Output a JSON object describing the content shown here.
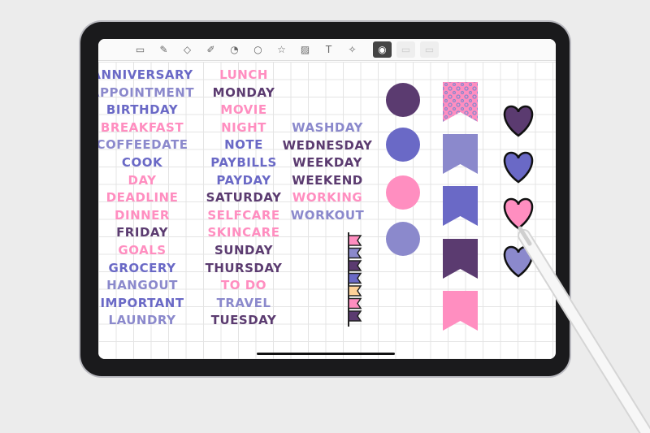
{
  "colors": {
    "dark": "#5b3b70",
    "indigo": "#6a69c6",
    "pink": "#ff8ec0",
    "lavender": "#8b89cc",
    "peach": "#ffd199"
  },
  "toolbar": {
    "tools": [
      {
        "icon": "pages-icon",
        "glyph": "▭"
      },
      {
        "icon": "pen-icon",
        "glyph": "✎"
      },
      {
        "icon": "eraser-icon",
        "glyph": "◇"
      },
      {
        "icon": "highlighter-icon",
        "glyph": "✐"
      },
      {
        "icon": "shapes-icon",
        "glyph": "◔"
      },
      {
        "icon": "lasso-icon",
        "glyph": "○"
      },
      {
        "icon": "sticker-icon",
        "glyph": "☆"
      },
      {
        "icon": "image-icon",
        "glyph": "▨"
      },
      {
        "icon": "text-icon",
        "glyph": "T"
      },
      {
        "icon": "laser-pointer-icon",
        "glyph": "✧"
      },
      {
        "icon": "camera-icon",
        "glyph": "◉"
      },
      {
        "icon": "photo-icon",
        "glyph": "▭"
      },
      {
        "icon": "more-icon",
        "glyph": "▭"
      }
    ]
  },
  "columns": [
    {
      "words": [
        [
          "ANNIVERSARY",
          "indigo"
        ],
        [
          "APPOINTMENT",
          "lavender"
        ],
        [
          "BIRTHDAY",
          "indigo"
        ],
        [
          "BREAKFAST",
          "pink"
        ],
        [
          "COFFEEDATE",
          "lavender"
        ],
        [
          "COOK",
          "indigo"
        ],
        [
          "DAY",
          "pink"
        ],
        [
          "DEADLINE",
          "pink"
        ],
        [
          "DINNER",
          "pink"
        ],
        [
          "FRIDAY",
          "dark"
        ],
        [
          "GOALS",
          "pink"
        ],
        [
          "GROCERY",
          "indigo"
        ],
        [
          "HANGOUT",
          "lavender"
        ],
        [
          "IMPORTANT",
          "indigo"
        ],
        [
          "LAUNDRY",
          "lavender"
        ]
      ]
    },
    {
      "words": [
        [
          "LUNCH",
          "pink"
        ],
        [
          "MONDAY",
          "dark"
        ],
        [
          "MOVIE",
          "pink"
        ],
        [
          "NIGHT",
          "pink"
        ],
        [
          "NOTE",
          "indigo"
        ],
        [
          "PAYBILLS",
          "indigo"
        ],
        [
          "PAYDAY",
          "indigo"
        ],
        [
          "SATURDAY",
          "dark"
        ],
        [
          "SELFCARE",
          "pink"
        ],
        [
          "SKINCARE",
          "pink"
        ],
        [
          "SUNDAY",
          "dark"
        ],
        [
          "THURSDAY",
          "dark"
        ],
        [
          "TO DO",
          "pink"
        ],
        [
          "TRAVEL",
          "lavender"
        ],
        [
          "TUESDAY",
          "dark"
        ]
      ]
    },
    {
      "words": [
        [
          "WASHDAY",
          "lavender"
        ],
        [
          "WEDNESDAY",
          "dark"
        ],
        [
          "WEEKDAY",
          "dark"
        ],
        [
          "WEEKEND",
          "dark"
        ],
        [
          "WORKING",
          "pink"
        ],
        [
          "WORKOUT",
          "lavender"
        ]
      ]
    }
  ],
  "mini_flags": [
    "pink",
    "lavender",
    "dark",
    "indigo",
    "peach",
    "pink",
    "dark"
  ],
  "circles": [
    "dark",
    "indigo",
    "pink",
    "lavender"
  ],
  "banners": [
    "leopard-pink",
    "lavender",
    "indigo",
    "dark",
    "pink"
  ],
  "hearts": [
    "dark",
    "indigo",
    "pink",
    "lavender"
  ]
}
